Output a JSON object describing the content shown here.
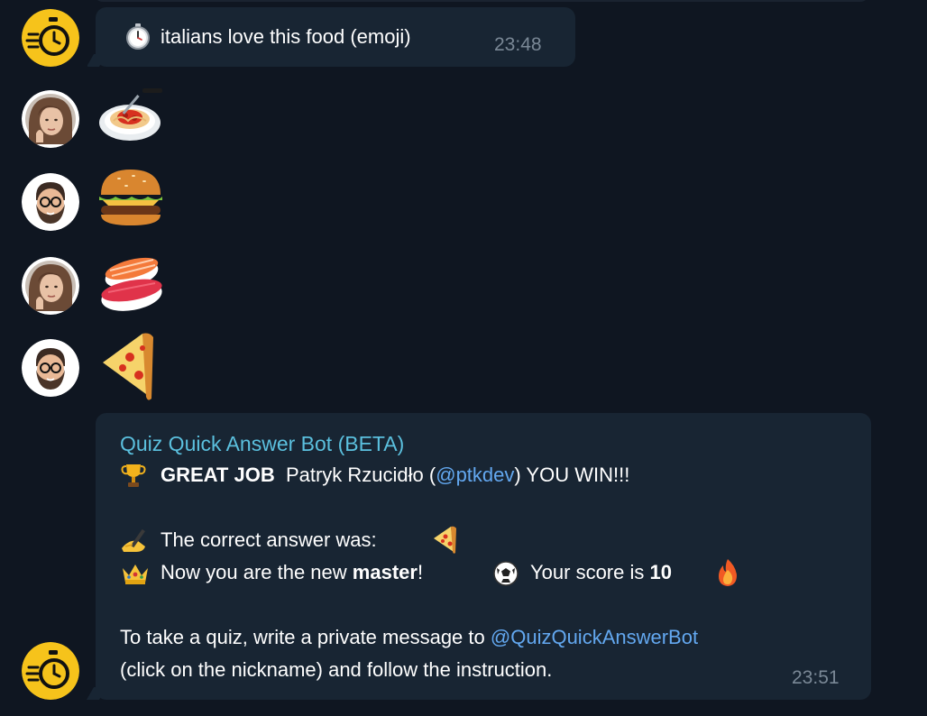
{
  "messages": {
    "prompt": {
      "icon": "stopwatch-icon",
      "text": "italians love this food (emoji)",
      "time": "23:48"
    },
    "answers": [
      {
        "avatar": "woman-avatar",
        "emoji_name": "spaghetti-icon"
      },
      {
        "avatar": "bearded-man-avatar",
        "emoji_name": "hamburger-icon"
      },
      {
        "avatar": "woman-avatar",
        "emoji_name": "sushi-icon"
      },
      {
        "avatar": "bearded-man-avatar",
        "emoji_name": "pizza-icon"
      }
    ],
    "result": {
      "sender": "Quiz Quick Answer Bot (BETA)",
      "great_job": "GREAT JOB",
      "winner_name": "Patryk Rzucidło (",
      "winner_handle": "@ptkdev",
      "winner_tail": ") YOU WIN!!!",
      "answer_label": "The correct answer was:",
      "master_prefix": "Now you are the new",
      "master_word": "master",
      "master_suffix": "!",
      "score_label": "Your score is",
      "score_value": "10",
      "cta_prefix": "To take a quiz, write a private message to",
      "cta_handle": "@QuizQuickAnswerBot",
      "cta_line2": "(click on the nickname) and follow the instruction.",
      "time": "23:51"
    }
  },
  "colors": {
    "background": "#0f1621",
    "bubble": "#182533",
    "sender": "#5bc0de",
    "mention": "#63a8f0",
    "bot_avatar": "#f6c31b"
  }
}
